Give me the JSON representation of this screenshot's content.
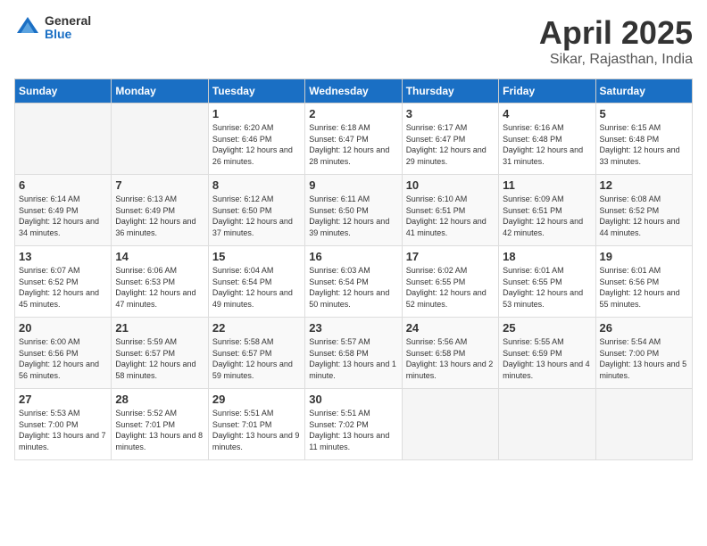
{
  "header": {
    "logo_general": "General",
    "logo_blue": "Blue",
    "title": "April 2025",
    "subtitle": "Sikar, Rajasthan, India"
  },
  "calendar": {
    "days_of_week": [
      "Sunday",
      "Monday",
      "Tuesday",
      "Wednesday",
      "Thursday",
      "Friday",
      "Saturday"
    ],
    "weeks": [
      [
        {
          "day": "",
          "info": ""
        },
        {
          "day": "",
          "info": ""
        },
        {
          "day": "1",
          "info": "Sunrise: 6:20 AM\nSunset: 6:46 PM\nDaylight: 12 hours and 26 minutes."
        },
        {
          "day": "2",
          "info": "Sunrise: 6:18 AM\nSunset: 6:47 PM\nDaylight: 12 hours and 28 minutes."
        },
        {
          "day": "3",
          "info": "Sunrise: 6:17 AM\nSunset: 6:47 PM\nDaylight: 12 hours and 29 minutes."
        },
        {
          "day": "4",
          "info": "Sunrise: 6:16 AM\nSunset: 6:48 PM\nDaylight: 12 hours and 31 minutes."
        },
        {
          "day": "5",
          "info": "Sunrise: 6:15 AM\nSunset: 6:48 PM\nDaylight: 12 hours and 33 minutes."
        }
      ],
      [
        {
          "day": "6",
          "info": "Sunrise: 6:14 AM\nSunset: 6:49 PM\nDaylight: 12 hours and 34 minutes."
        },
        {
          "day": "7",
          "info": "Sunrise: 6:13 AM\nSunset: 6:49 PM\nDaylight: 12 hours and 36 minutes."
        },
        {
          "day": "8",
          "info": "Sunrise: 6:12 AM\nSunset: 6:50 PM\nDaylight: 12 hours and 37 minutes."
        },
        {
          "day": "9",
          "info": "Sunrise: 6:11 AM\nSunset: 6:50 PM\nDaylight: 12 hours and 39 minutes."
        },
        {
          "day": "10",
          "info": "Sunrise: 6:10 AM\nSunset: 6:51 PM\nDaylight: 12 hours and 41 minutes."
        },
        {
          "day": "11",
          "info": "Sunrise: 6:09 AM\nSunset: 6:51 PM\nDaylight: 12 hours and 42 minutes."
        },
        {
          "day": "12",
          "info": "Sunrise: 6:08 AM\nSunset: 6:52 PM\nDaylight: 12 hours and 44 minutes."
        }
      ],
      [
        {
          "day": "13",
          "info": "Sunrise: 6:07 AM\nSunset: 6:52 PM\nDaylight: 12 hours and 45 minutes."
        },
        {
          "day": "14",
          "info": "Sunrise: 6:06 AM\nSunset: 6:53 PM\nDaylight: 12 hours and 47 minutes."
        },
        {
          "day": "15",
          "info": "Sunrise: 6:04 AM\nSunset: 6:54 PM\nDaylight: 12 hours and 49 minutes."
        },
        {
          "day": "16",
          "info": "Sunrise: 6:03 AM\nSunset: 6:54 PM\nDaylight: 12 hours and 50 minutes."
        },
        {
          "day": "17",
          "info": "Sunrise: 6:02 AM\nSunset: 6:55 PM\nDaylight: 12 hours and 52 minutes."
        },
        {
          "day": "18",
          "info": "Sunrise: 6:01 AM\nSunset: 6:55 PM\nDaylight: 12 hours and 53 minutes."
        },
        {
          "day": "19",
          "info": "Sunrise: 6:01 AM\nSunset: 6:56 PM\nDaylight: 12 hours and 55 minutes."
        }
      ],
      [
        {
          "day": "20",
          "info": "Sunrise: 6:00 AM\nSunset: 6:56 PM\nDaylight: 12 hours and 56 minutes."
        },
        {
          "day": "21",
          "info": "Sunrise: 5:59 AM\nSunset: 6:57 PM\nDaylight: 12 hours and 58 minutes."
        },
        {
          "day": "22",
          "info": "Sunrise: 5:58 AM\nSunset: 6:57 PM\nDaylight: 12 hours and 59 minutes."
        },
        {
          "day": "23",
          "info": "Sunrise: 5:57 AM\nSunset: 6:58 PM\nDaylight: 13 hours and 1 minute."
        },
        {
          "day": "24",
          "info": "Sunrise: 5:56 AM\nSunset: 6:58 PM\nDaylight: 13 hours and 2 minutes."
        },
        {
          "day": "25",
          "info": "Sunrise: 5:55 AM\nSunset: 6:59 PM\nDaylight: 13 hours and 4 minutes."
        },
        {
          "day": "26",
          "info": "Sunrise: 5:54 AM\nSunset: 7:00 PM\nDaylight: 13 hours and 5 minutes."
        }
      ],
      [
        {
          "day": "27",
          "info": "Sunrise: 5:53 AM\nSunset: 7:00 PM\nDaylight: 13 hours and 7 minutes."
        },
        {
          "day": "28",
          "info": "Sunrise: 5:52 AM\nSunset: 7:01 PM\nDaylight: 13 hours and 8 minutes."
        },
        {
          "day": "29",
          "info": "Sunrise: 5:51 AM\nSunset: 7:01 PM\nDaylight: 13 hours and 9 minutes."
        },
        {
          "day": "30",
          "info": "Sunrise: 5:51 AM\nSunset: 7:02 PM\nDaylight: 13 hours and 11 minutes."
        },
        {
          "day": "",
          "info": ""
        },
        {
          "day": "",
          "info": ""
        },
        {
          "day": "",
          "info": ""
        }
      ]
    ]
  }
}
